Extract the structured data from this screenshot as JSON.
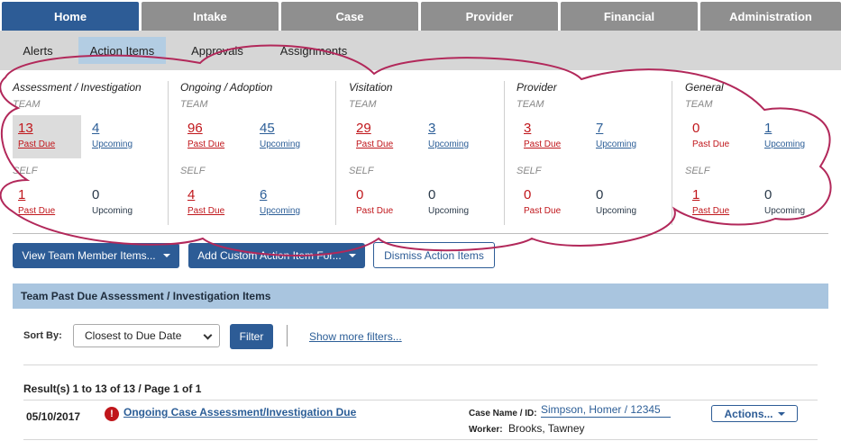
{
  "topnav": {
    "tabs": [
      "Home",
      "Intake",
      "Case",
      "Provider",
      "Financial",
      "Administration"
    ],
    "active": "Home"
  },
  "subnav": {
    "tabs": [
      "Alerts",
      "Action Items",
      "Approvals",
      "Assignments"
    ],
    "active": "Action Items"
  },
  "summary": {
    "team_label": "TEAM",
    "self_label": "SELF",
    "past_due_label": "Past Due",
    "upcoming_label": "Upcoming",
    "columns": [
      {
        "title": "Assessment / Investigation",
        "team": {
          "past_due": "13",
          "upcoming": "4"
        },
        "self": {
          "past_due": "1",
          "upcoming": "0"
        }
      },
      {
        "title": "Ongoing / Adoption",
        "team": {
          "past_due": "96",
          "upcoming": "45"
        },
        "self": {
          "past_due": "4",
          "upcoming": "6"
        }
      },
      {
        "title": "Visitation",
        "team": {
          "past_due": "29",
          "upcoming": "3"
        },
        "self": {
          "past_due": "0",
          "upcoming": "0"
        }
      },
      {
        "title": "Provider",
        "team": {
          "past_due": "3",
          "upcoming": "7"
        },
        "self": {
          "past_due": "0",
          "upcoming": "0"
        }
      },
      {
        "title": "General",
        "team": {
          "past_due": "0",
          "upcoming": "1"
        },
        "self": {
          "past_due": "1",
          "upcoming": "0"
        }
      }
    ]
  },
  "buttons": {
    "view_team": "View Team Member Items...",
    "add_custom": "Add Custom Action Item For...",
    "dismiss": "Dismiss Action Items"
  },
  "section": {
    "title": "Team Past Due Assessment / Investigation Items"
  },
  "filters": {
    "sort_label": "Sort By:",
    "sort_value": "Closest to Due Date",
    "filter_button": "Filter",
    "more_filters": "Show more filters..."
  },
  "results": {
    "summary": "Result(s) 1 to 13 of 13 / Page 1 of 1",
    "rows": [
      {
        "date": "05/10/2017",
        "title": "Ongoing Case Assessment/Investigation Due",
        "case_label": "Case Name / ID:",
        "case_value": "Simpson, Homer / 12345",
        "worker_label": "Worker:",
        "worker_value": "Brooks, Tawney",
        "actions_label": "Actions..."
      }
    ]
  },
  "colors": {
    "nav_active": "#2d5c96",
    "nav_inactive": "#8f8f8f",
    "past_due": "#c0161b",
    "upcoming": "#2c5e97",
    "section_bg": "#a9c5df",
    "annotation": "#b2285a"
  }
}
